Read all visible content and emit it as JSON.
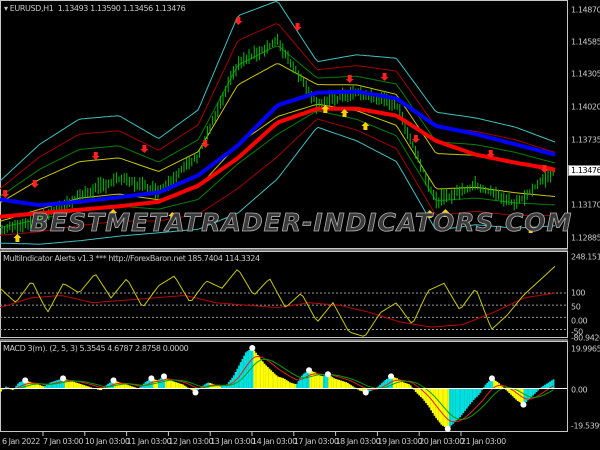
{
  "main": {
    "symbol_label": "EURUSD,H1",
    "ohlc": "1.13493 1.13590 1.13456 1.13476",
    "price_axis": [
      "1.14870",
      "1.14585",
      "1.14305",
      "1.14020",
      "1.13735",
      "1.13476",
      "1.13170",
      "1.12885"
    ],
    "price_axis_values": [
      1.1487,
      1.14585,
      1.14305,
      1.1402,
      1.13735,
      1.1317,
      1.12885
    ],
    "current_price": "1.13476",
    "watermark": "BESTMETATRADER-INDICATORS.COM",
    "colors": {
      "slow_ma": "#ff0000",
      "fast_ma": "#0000ff",
      "outer_band": "#40c0c0",
      "inner_band": "#c8c800",
      "bars": "#00c000"
    },
    "series": {
      "slow_ma": [
        1.1307,
        1.131,
        1.1313,
        1.1316,
        1.132,
        1.1334,
        1.1358,
        1.1389,
        1.1401,
        1.1401,
        1.1395,
        1.1373,
        1.1361,
        1.1354,
        1.1348
      ],
      "fast_ma": [
        1.1322,
        1.1317,
        1.132,
        1.1324,
        1.1328,
        1.1343,
        1.1369,
        1.1404,
        1.1415,
        1.1416,
        1.141,
        1.1386,
        1.1379,
        1.137,
        1.1361
      ],
      "upper_band": [
        1.1338,
        1.137,
        1.1392,
        1.1395,
        1.1375,
        1.14,
        1.1482,
        1.1495,
        1.1442,
        1.1448,
        1.1445,
        1.1398,
        1.1393,
        1.1385,
        1.1372
      ],
      "lower_band": [
        1.1284,
        1.1283,
        1.1286,
        1.129,
        1.1293,
        1.1296,
        1.131,
        1.134,
        1.1385,
        1.1373,
        1.1355,
        1.1295,
        1.13,
        1.1297,
        1.1299
      ],
      "close": [
        1.1295,
        1.1305,
        1.1325,
        1.134,
        1.133,
        1.136,
        1.144,
        1.146,
        1.1405,
        1.1415,
        1.1405,
        1.132,
        1.1335,
        1.1318,
        1.1348
      ]
    },
    "sell_arrows": [
      [
        3,
        1.13259
      ],
      [
        20,
        1.13346
      ],
      [
        55,
        1.1359
      ],
      [
        83,
        1.13651
      ],
      [
        118,
        1.13694
      ],
      [
        137,
        1.14765
      ],
      [
        171,
        1.14713
      ],
      [
        201,
        1.1426
      ],
      [
        221,
        1.14278
      ],
      [
        239,
        1.13738
      ],
      [
        282,
        1.13607
      ],
      [
        313,
        1.13476
      ]
    ],
    "buy_arrows": [
      [
        10,
        1.12893
      ],
      [
        65,
        1.13111
      ],
      [
        99,
        1.13084
      ],
      [
        187,
        1.14016
      ],
      [
        198,
        1.13982
      ],
      [
        210,
        1.13868
      ],
      [
        247,
        1.13102
      ],
      [
        256,
        1.13111
      ],
      [
        305,
        1.12971
      ]
    ]
  },
  "oscillator": {
    "title": "MultiIndicator Alerts v1.3 *** http://ForexBaron.net 185.7404 114.3324",
    "axis": [
      "248.1513",
      "100",
      "50",
      "0.00",
      "-50",
      "-80.9426"
    ],
    "levels": [
      100,
      50,
      0,
      -50
    ],
    "range": [
      -80.9426,
      248.1513
    ],
    "yellow": [
      120,
      60,
      150,
      20,
      140,
      100,
      180,
      80,
      160,
      40,
      130,
      170,
      60,
      150,
      120,
      200,
      90,
      160,
      40,
      100,
      -20,
      60,
      -60,
      -80,
      20,
      60,
      -30,
      110,
      140,
      30,
      120,
      -50,
      10,
      90,
      150,
      210
    ],
    "red": [
      40,
      80,
      90,
      60,
      70,
      80,
      90,
      60,
      50,
      40,
      60,
      50,
      20,
      -20,
      -40,
      -30,
      20,
      80,
      100
    ]
  },
  "macd": {
    "title": "MACD 3(m). (2, 5, 3) 5.3545 4.6787 2.8758 0.0000",
    "axis": [
      "19.9965",
      "0.00",
      "-19.5399"
    ],
    "range": [
      -19.5399,
      19.9965
    ],
    "histogram": [
      -2,
      1,
      -1,
      3,
      4,
      3,
      2,
      1,
      3,
      4,
      5,
      4,
      3,
      2,
      1,
      0,
      -1,
      2,
      4,
      3,
      2,
      1,
      0,
      3,
      5,
      4,
      6,
      4,
      3,
      2,
      0,
      -2,
      1,
      3,
      2,
      1,
      2,
      6,
      12,
      18,
      20,
      16,
      12,
      9,
      6,
      5,
      3,
      2,
      7,
      9,
      8,
      6,
      7,
      5,
      4,
      3,
      1,
      -1,
      -2,
      -1,
      1,
      4,
      6,
      5,
      3,
      2,
      -2,
      -5,
      -9,
      -14,
      -18,
      -20,
      -17,
      -14,
      -10,
      -6,
      -3,
      2,
      5,
      3,
      0,
      -3,
      -6,
      -8,
      -5,
      -2,
      1,
      3,
      5
    ]
  },
  "time_axis": [
    "6 Jan 2022",
    "7 Jan 03:00",
    "10 Jan 03:00",
    "11 Jan 03:00",
    "12 Jan 03:00",
    "13 Jan 03:00",
    "14 Jan 03:00",
    "17 Jan 03:00",
    "18 Jan 03:00",
    "19 Jan 03:00",
    "20 Jan 03:00",
    "21 Jan 03:00"
  ]
}
